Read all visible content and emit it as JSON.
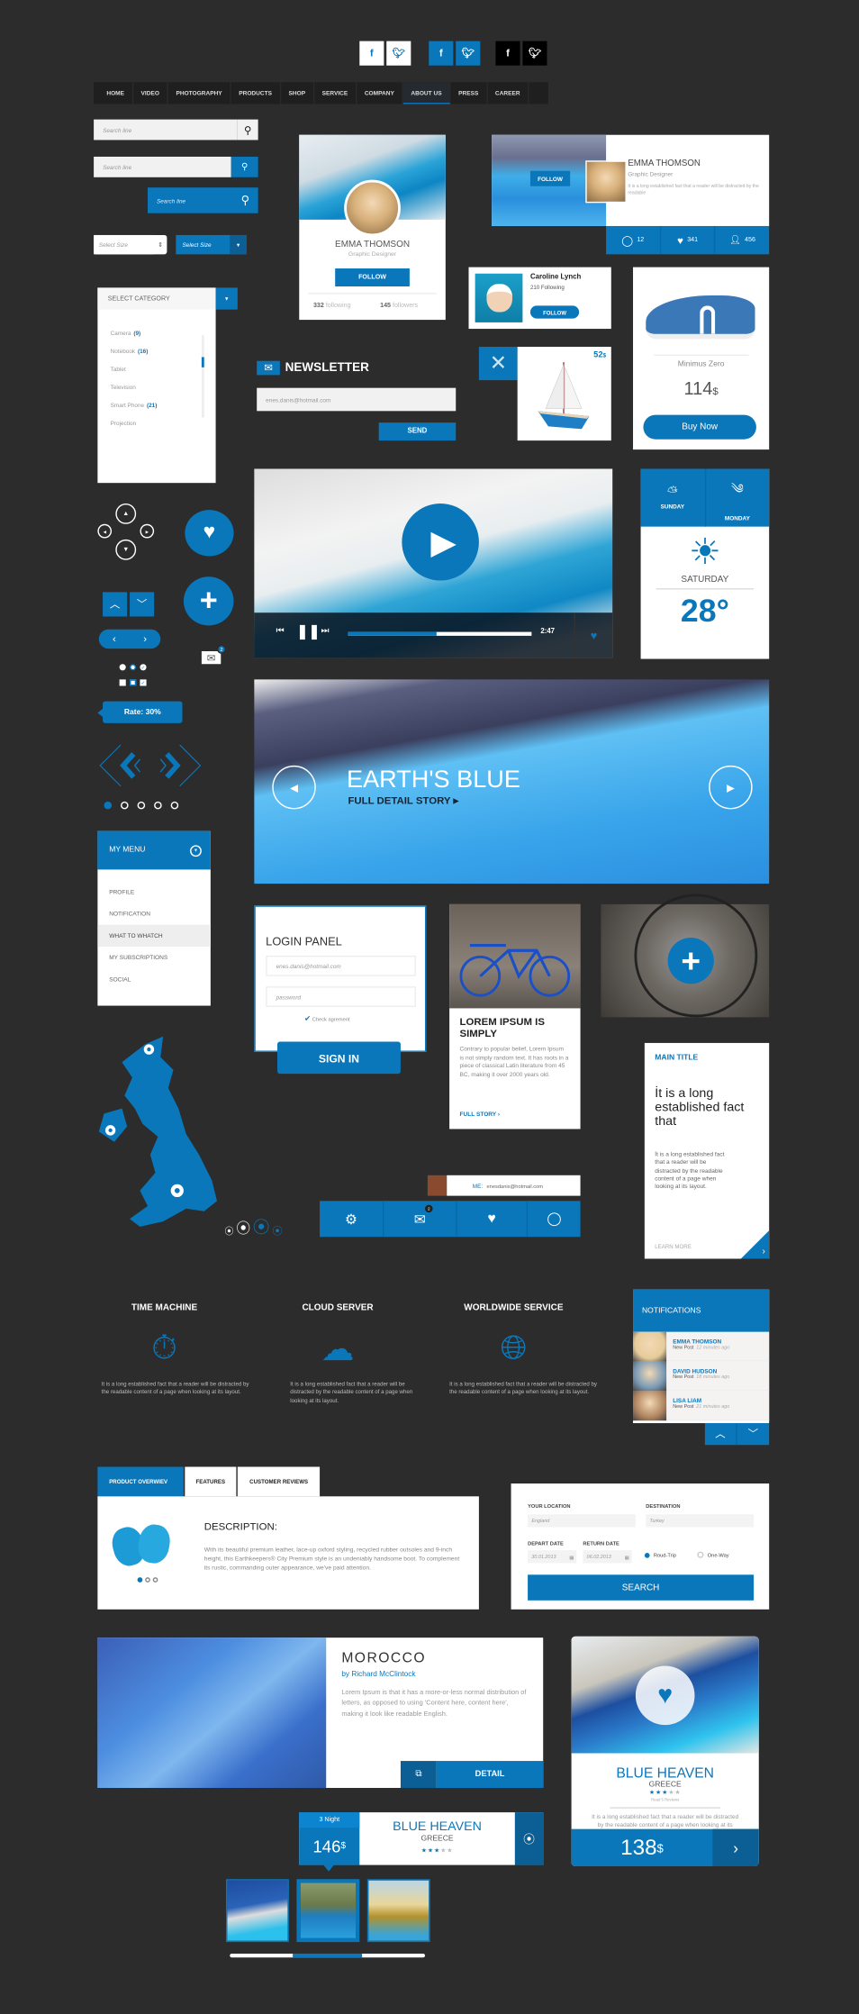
{
  "colors": {
    "accent": "#0a77bb",
    "accent_dark": "#0b5f94",
    "background": "#2c2c2c"
  },
  "social": [
    {
      "icon": "facebook-icon",
      "glyph": "f"
    },
    {
      "icon": "twitter-icon",
      "glyph": "t"
    }
  ],
  "nav": {
    "items": [
      "HOME",
      "VIDEO",
      "PHOTOGRAPHY",
      "PRODUCTS",
      "SHOP",
      "SERVICE",
      "COMPANY",
      "ABOUT US",
      "PRESS",
      "CAREER"
    ],
    "active": "ABOUT US"
  },
  "search": {
    "placeholder": "Search line"
  },
  "selects": {
    "placeholder": "Select Size"
  },
  "profile_card": {
    "name": "EMMA THOMSON",
    "role": "Graphic Designer",
    "follow": "FOLLOW",
    "following_count": "332",
    "following_label": "following",
    "followers_count": "145",
    "followers_label": "followers"
  },
  "profile_wide": {
    "follow": "FOLLOW",
    "name": "EMMA THOMSON",
    "role": "Graphic Designer",
    "bio": "It is a long established fact that a reader will be distracted by the readable",
    "comments": "12",
    "likes": "341",
    "followers": "456"
  },
  "caroline": {
    "name": "Caroline Lynch",
    "following": "210 Following",
    "follow": "FOLLOW"
  },
  "product": {
    "name": "Minimus Zero",
    "price": "114",
    "currency": "$",
    "buy": "Buy Now"
  },
  "boat": {
    "price": "52",
    "currency": "$"
  },
  "newsletter": {
    "title": "NEWSLETTER",
    "email": "enes.danis@hotmail.com",
    "send": "SEND"
  },
  "category": {
    "title": "SELECT CATEGORY",
    "items": [
      {
        "label": "Camera",
        "count": "(9)"
      },
      {
        "label": "Notebook",
        "count": "(16)"
      },
      {
        "label": "Tablet",
        "count": ""
      },
      {
        "label": "Television",
        "count": ""
      },
      {
        "label": "Smart Phone",
        "count": "(21)"
      },
      {
        "label": "Projection",
        "count": ""
      }
    ],
    "scroll_position": 0.25
  },
  "mail_badge": "2",
  "rate": "Rate: 30%",
  "video": {
    "time": "2:47",
    "progress": 0.48
  },
  "weather": {
    "days": [
      "SUNDAY",
      "MONDAY"
    ],
    "today": "SATURDAY",
    "temp": "28°"
  },
  "banner": {
    "title": "EARTH'S BLUE",
    "link": "FULL DETAIL STORY ▸"
  },
  "my_menu": {
    "title": "MY MENU",
    "items": [
      "PROFILE",
      "NOTIFICATION",
      "WHAT TO WHATCH",
      "MY SUBSCRIPTIONS",
      "SOCIAL"
    ],
    "selected": "WHAT TO WHATCH"
  },
  "login": {
    "title": "LOGIN PANEL",
    "email_placeholder": "enes.danis@hotmail.com",
    "password_placeholder": "password",
    "agree": "Check agrement",
    "submit": "SIGN IN"
  },
  "article": {
    "title": "LOREM IPSUM IS SIMPLY",
    "body": "Contrary to popular belief, Lorem Ipsum is not simply random text. It has roots in a piece of classical Latin literature from 45 BC, making it over 2000 years old.",
    "link": "FULL STORY"
  },
  "main_card": {
    "label": "MAIN TITLE",
    "headline": "İt is a long established fact that",
    "body": "İt is a long established fact that a reader will be distracted by the readable content of a page when looking at its layout.",
    "link": "LEARN MORE"
  },
  "chat": {
    "label": "ME:",
    "email": "enesdanis@hotmail.com"
  },
  "toolbar": {
    "mail_badge": "2"
  },
  "features": [
    {
      "title": "TIME MACHINE",
      "icon": "stopwatch-icon",
      "text": "It is a long established fact that a reader will be distracted by the readable content of a page when looking at its layout."
    },
    {
      "title": "CLOUD SERVER",
      "icon": "cloud-icon",
      "text": "It is a long established fact that a reader will be distracted by the readable content of a page when looking at its layout."
    },
    {
      "title": "WORLDWIDE SERVICE",
      "icon": "globe-icon",
      "text": "It is a long established fact that a reader will be distracted by the readable content of a page when looking at its layout."
    }
  ],
  "notifications": {
    "title": "NOTIFICATIONS",
    "items": [
      {
        "name": "EMMA THOMSON",
        "action": "New Post",
        "time": "12 minutes ago"
      },
      {
        "name": "DAVID HUDSON",
        "action": "New Post",
        "time": "18 minutes ago"
      },
      {
        "name": "LISA LIAM",
        "action": "New Post",
        "time": "21 minutes ago"
      }
    ]
  },
  "product_tabs": {
    "tabs": [
      "PRODUCT OVERWIEV",
      "FEATURES",
      "CUSTOMER REVIEWS"
    ],
    "active": "PRODUCT OVERWIEV",
    "heading": "DESCRIPTION:",
    "text": "With its beautiful premium leather, lace-up oxford styling, recycled rubber outsoles and 9-inch height, this Earthkeepers® City Premium style is an undeniably handsome boot. To complement its rustic, commanding outer appearance, we've paid attention."
  },
  "travel_search": {
    "location_label": "YOUR LOCATION",
    "location": "England",
    "destination_label": "DESTINATION",
    "destination": "Turkey",
    "depart_label": "DEPART DATE",
    "depart": "30.01.2013",
    "return_label": "RETURN DATE",
    "return": "06.02.2013",
    "round_trip": "Roud-Trip",
    "one_way": "One-Way",
    "selected": "Roud-Trip",
    "submit": "SEARCH"
  },
  "morocco": {
    "title": "MOROCCO",
    "author": "by Richard McClintock",
    "text": "Lorem Ipsum is that it has a more-or-less normal distribution of letters, as opposed to using 'Content here, content here', making it look like readable English.",
    "detail": "DETAIL"
  },
  "blue_heaven_card": {
    "title": "BLUE HEAVEN",
    "country": "GREECE",
    "rating": 3,
    "reviews": "Read 5 Reviews",
    "text": "It is a long established fact that a reader will be distracted by the readable content of a page when looking at its layout.",
    "price": "138",
    "currency": "$"
  },
  "blue_heaven_small": {
    "nights": "3 Night",
    "price": "146",
    "currency": "$",
    "title": "BLUE HEAVEN",
    "country": "GREECE",
    "rating": 3
  },
  "gallery": {
    "selected_index": 1,
    "scroll_position": 0.33
  }
}
